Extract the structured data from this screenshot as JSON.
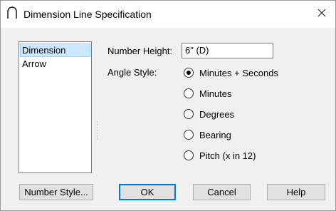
{
  "window": {
    "title": "Dimension Line Specification",
    "icon": "dimension-arc-icon",
    "close_icon": "close-icon"
  },
  "sidebar": {
    "items": [
      {
        "label": "Dimension",
        "selected": true
      },
      {
        "label": "Arrow",
        "selected": false
      }
    ]
  },
  "form": {
    "number_height_label": "Number Height:",
    "number_height_value": "6\" (D)",
    "angle_style_label": "Angle Style:",
    "angle_options": [
      {
        "label": "Minutes + Seconds",
        "checked": true
      },
      {
        "label": "Minutes",
        "checked": false
      },
      {
        "label": "Degrees",
        "checked": false
      },
      {
        "label": "Bearing",
        "checked": false
      },
      {
        "label": "Pitch (x in 12)",
        "checked": false
      }
    ]
  },
  "buttons": {
    "number_style": "Number Style...",
    "ok": "OK",
    "cancel": "Cancel",
    "help": "Help"
  },
  "colors": {
    "selection_bg": "#cce8ff",
    "default_button_border": "#0078d7"
  }
}
